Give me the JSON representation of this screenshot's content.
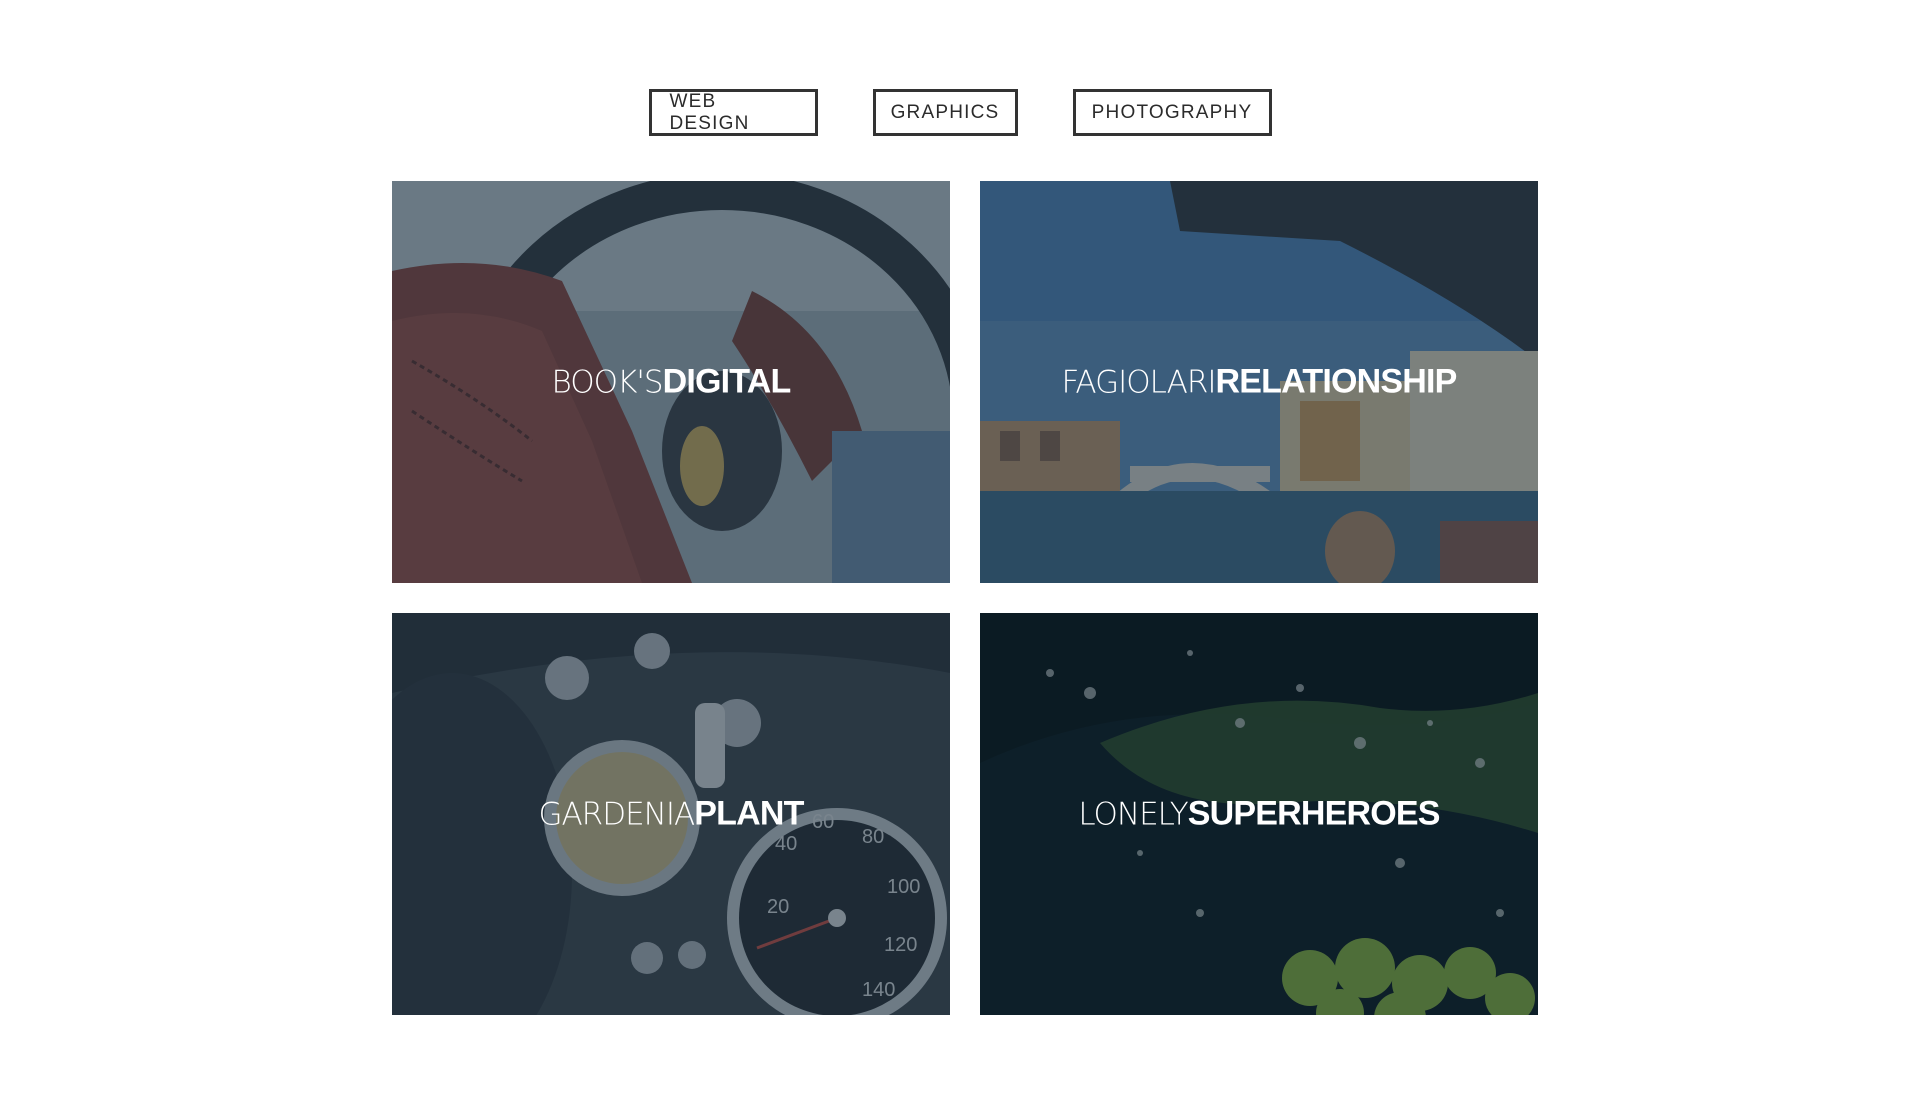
{
  "filters": [
    {
      "label": "WEB DESIGN"
    },
    {
      "label": "GRAPHICS"
    },
    {
      "label": "PHOTOGRAPHY"
    }
  ],
  "portfolio": [
    {
      "title_light": "BOOK'S",
      "title_bold": "DIGITAL",
      "image": "gloved-hand-on-steering-wheel"
    },
    {
      "title_light": "FAGIOLARI",
      "title_bold": "RELATIONSHIP",
      "image": "venice-grand-canal-rialto-bridge"
    },
    {
      "title_light": "GARDENIA",
      "title_bold": "PLANT",
      "image": "vintage-car-dashboard-speedometer"
    },
    {
      "title_light": "LONELY",
      "title_bold": "SUPERHEROES",
      "image": "grapes-splashing-in-water"
    }
  ],
  "speedometer_ticks": [
    "20",
    "40",
    "60",
    "80",
    "100",
    "120",
    "140"
  ],
  "colors": {
    "overlay": "#1e3242",
    "button_border": "#333333",
    "background": "#ffffff"
  }
}
